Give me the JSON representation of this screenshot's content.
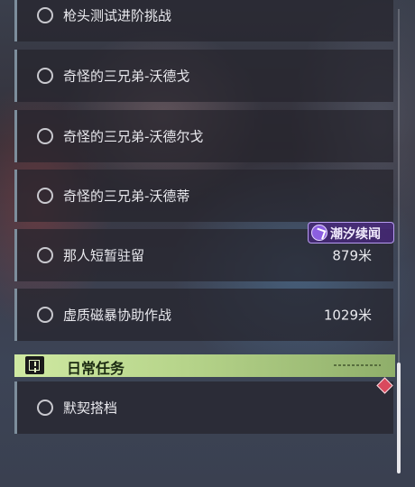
{
  "quests": [
    {
      "label": "枪头测试进阶挑战",
      "distance": ""
    },
    {
      "label": "奇怪的三兄弟-沃德戈",
      "distance": ""
    },
    {
      "label": "奇怪的三兄弟-沃德尔戈",
      "distance": ""
    },
    {
      "label": "奇怪的三兄弟-沃德蒂",
      "distance": ""
    },
    {
      "label": "那人短暂驻留",
      "distance": "879米"
    },
    {
      "label": "虚质磁暴协助作战",
      "distance": "1029米"
    }
  ],
  "badge": {
    "text": "潮汐续闻",
    "icon": "tidal-event-icon"
  },
  "daily_section": {
    "title": "日常任务",
    "icon": "exclamation-icon"
  },
  "daily_quests": [
    {
      "label": "默契搭档"
    }
  ],
  "colors": {
    "row_border": "#7d8e9c",
    "section_green": "#b6d48a",
    "badge_purple": "#8c5fe0",
    "marker_red": "#d94a5e"
  }
}
